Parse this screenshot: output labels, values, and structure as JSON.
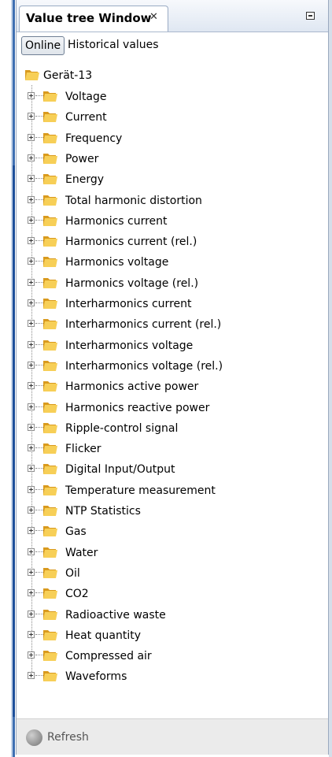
{
  "window": {
    "tab_title": "Value tree Window",
    "tab_close_glyph": "✕",
    "minimize_icon": "minimize-icon"
  },
  "modes": {
    "online_label": "Online",
    "historical_label": "Historical values"
  },
  "tree": {
    "root_label": "Gerät-13",
    "items": [
      {
        "label": "Voltage"
      },
      {
        "label": "Current"
      },
      {
        "label": "Frequency"
      },
      {
        "label": "Power"
      },
      {
        "label": "Energy"
      },
      {
        "label": "Total harmonic distortion"
      },
      {
        "label": "Harmonics current"
      },
      {
        "label": "Harmonics current (rel.)"
      },
      {
        "label": "Harmonics voltage"
      },
      {
        "label": "Harmonics voltage (rel.)"
      },
      {
        "label": "Interharmonics current"
      },
      {
        "label": "Interharmonics current (rel.)"
      },
      {
        "label": "Interharmonics voltage"
      },
      {
        "label": "Interharmonics voltage (rel.)"
      },
      {
        "label": "Harmonics active power"
      },
      {
        "label": "Harmonics reactive power"
      },
      {
        "label": "Ripple-control signal"
      },
      {
        "label": "Flicker"
      },
      {
        "label": "Digital Input/Output"
      },
      {
        "label": "Temperature measurement"
      },
      {
        "label": "NTP Statistics"
      },
      {
        "label": "Gas"
      },
      {
        "label": "Water"
      },
      {
        "label": "Oil"
      },
      {
        "label": "CO2"
      },
      {
        "label": "Radioactive waste"
      },
      {
        "label": "Heat quantity"
      },
      {
        "label": "Compressed air"
      },
      {
        "label": "Waveforms"
      }
    ]
  },
  "footer": {
    "refresh_label": "Refresh"
  },
  "colors": {
    "folder_light": "#f7cf57",
    "folder_dark": "#d99a1e",
    "frame_blue": "#3f6fb2"
  }
}
